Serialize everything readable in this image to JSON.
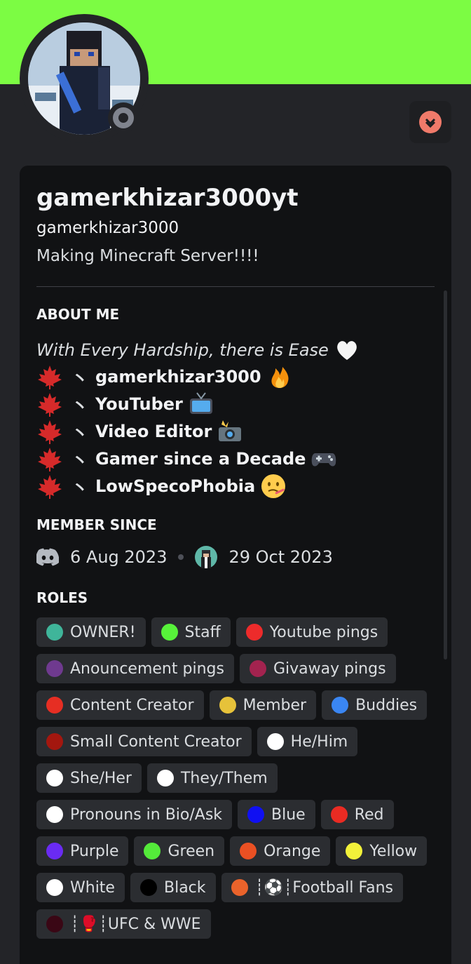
{
  "profile": {
    "display_name": "gamerkhizar3000yt",
    "username": "gamerkhizar3000",
    "custom_status": "Making Minecraft Server!!!!",
    "banner_color": "#7cfc43",
    "status": "offline"
  },
  "about": {
    "title": "ABOUT ME",
    "intro": "With Every Hardship, there is Ease",
    "lines": [
      {
        "text": "gamerkhizar3000",
        "emoji": "fire-icon"
      },
      {
        "text": "YouTuber",
        "emoji": "tv-icon"
      },
      {
        "text": "Video Editor",
        "emoji": "camera-flash-icon"
      },
      {
        "text": "Gamer since a Decade",
        "emoji": "gamepad-icon"
      },
      {
        "text": "LowSpecoPhobia",
        "emoji": "sick-face-icon"
      }
    ],
    "slash": "丶"
  },
  "member_since": {
    "title": "MEMBER SINCE",
    "discord_date": "6 Aug 2023",
    "server_date": "29 Oct 2023"
  },
  "roles": {
    "title": "ROLES",
    "items": [
      {
        "name": "OWNER!",
        "color": "#3fb59a"
      },
      {
        "name": "Staff",
        "color": "#57f23a"
      },
      {
        "name": "Youtube pings",
        "color": "#ed2b2b"
      },
      {
        "name": "Anouncement pings",
        "color": "#6f3a8f"
      },
      {
        "name": "Givaway pings",
        "color": "#a3234f"
      },
      {
        "name": "Content Creator",
        "color": "#e62e23"
      },
      {
        "name": "Member",
        "color": "#e6c23a"
      },
      {
        "name": "Buddies",
        "color": "#3a86f2"
      },
      {
        "name": "Small Content Creator",
        "color": "#a3170f"
      },
      {
        "name": "He/Him",
        "color": "#ffffff"
      },
      {
        "name": "She/Her",
        "color": "#ffffff"
      },
      {
        "name": "They/Them",
        "color": "#ffffff"
      },
      {
        "name": "Pronouns in Bio/Ask",
        "color": "#ffffff"
      },
      {
        "name": "Blue",
        "color": "#1010f2"
      },
      {
        "name": "Red",
        "color": "#ea2b23"
      },
      {
        "name": "Purple",
        "color": "#6a2bf2"
      },
      {
        "name": "Green",
        "color": "#54ea3a"
      },
      {
        "name": "Orange",
        "color": "#ea5023"
      },
      {
        "name": "Yellow",
        "color": "#f2f23a"
      },
      {
        "name": "White",
        "color": "#ffffff"
      },
      {
        "name": "Black",
        "color": "#000000"
      },
      {
        "name": "┊⚽┊Football Fans",
        "color": "#ea632b"
      },
      {
        "name": "┊🥊┊UFC & WWE",
        "color": "#3a0715"
      }
    ]
  }
}
